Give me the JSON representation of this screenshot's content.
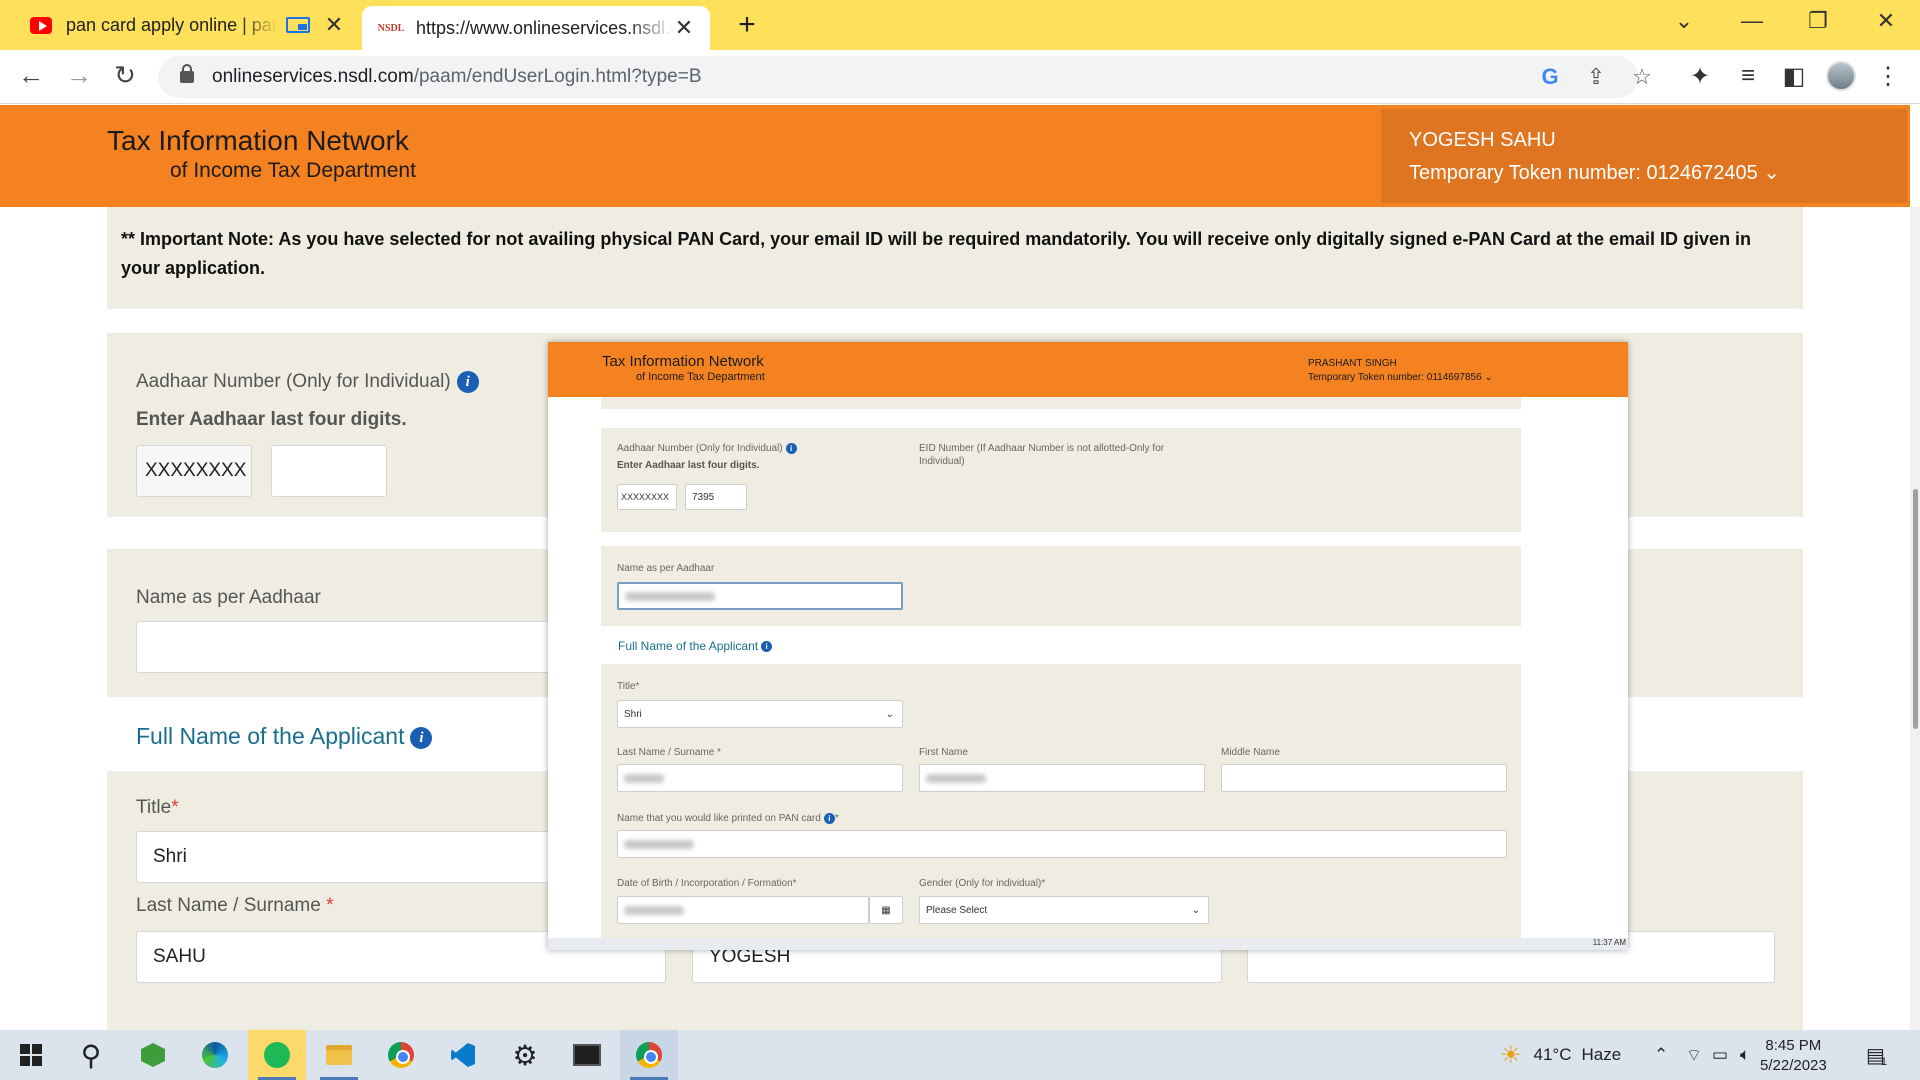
{
  "browser": {
    "tabs": [
      {
        "title": "pan card apply online | pan c",
        "favicon": "youtube-icon"
      },
      {
        "title": "https://www.onlineservices.nsdl.c",
        "favicon": "nsdl-icon"
      }
    ],
    "favicon_text": "NSDL",
    "url_host": "onlineservices.nsdl.com",
    "url_path": "/paam/endUserLogin.html?type=B",
    "tab_close": "✕",
    "new_tab": "+"
  },
  "header": {
    "logo_line1": "Tax Information Network",
    "logo_line2": "of Income Tax Department",
    "user_name": "YOGESH SAHU",
    "token": "Temporary Token number: 0124672405 ⌄",
    "bg_color": "#f58220"
  },
  "note": "** Important Note: As you have selected for not availing physical PAN Card, your email ID will be required mandatorily. You will receive only digitally signed e-PAN Card at the email ID given in your application.",
  "form": {
    "aadhaar_label": "Aadhaar Number (Only for Individual)",
    "aadhaar_hint": "Enter Aadhaar last four digits.",
    "aadhaar_masked": "XXXXXXXX",
    "aadhaar_last4": "",
    "name_aadhaar_label": "Name as per Aadhaar",
    "name_aadhaar_value": "",
    "full_name_section": "Full Name of the Applicant",
    "title_label": "Title",
    "title_value": "Shri",
    "last_name_label": "Last Name / Surname ",
    "last_name_value": "SAHU",
    "first_name_value": "YOGESH",
    "middle_name_value": "",
    "required_mark": "*"
  },
  "overlay": {
    "logo_line1": "Tax Information Network",
    "logo_line2": "of Income Tax Department",
    "user_name": "PRASHANT SINGH",
    "token": "Temporary Token number: 0114697856 ⌄",
    "aadhaar_label": "Aadhaar Number (Only for Individual)",
    "aadhaar_hint": "Enter Aadhaar last four digits.",
    "aadhaar_masked": "XXXXXXXX",
    "aadhaar_last4": "7395",
    "eid_label": "EID Number (If Aadhaar Number is not allotted-Only for Individual)",
    "name_aadhaar_label": "Name as per Aadhaar",
    "full_name_section": "Full Name of the Applicant",
    "title_label": "Title*",
    "title_value": "Shri",
    "last_name_label": "Last Name / Surname *",
    "first_name_label": "First Name",
    "middle_name_label": "Middle Name",
    "print_name_label": "Name that you would like printed on PAN card",
    "dob_label": "Date of Birth / Incorporation / Formation*",
    "gender_label": "Gender (Only for individual)*",
    "gender_value": "Please Select",
    "time": "11:37 AM"
  },
  "taskbar": {
    "weather_temp": "41°C",
    "weather_text": "Haze",
    "time": "8:45 PM",
    "date": "5/22/2023",
    "notif_count": "1",
    "apps": [
      "start-icon",
      "search-icon",
      "cube-app-icon",
      "edge-icon",
      "spotify-icon",
      "file-explorer-icon",
      "chrome-icon",
      "vscode-icon",
      "settings-icon",
      "terminal-icon",
      "chrome-profile-icon"
    ]
  }
}
